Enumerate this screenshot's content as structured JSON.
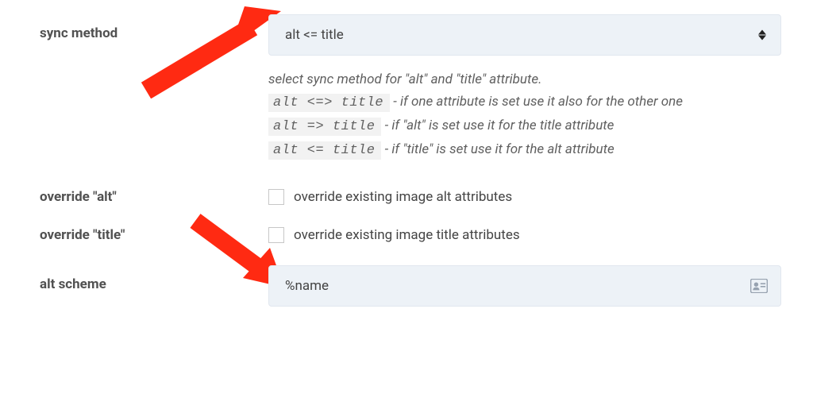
{
  "sync_method": {
    "label": "sync method",
    "selected": "alt <= title",
    "help_intro": "select sync method for \"alt\" and \"title\" attribute.",
    "opt1_code": "alt <=> title",
    "opt1_desc": " - if one attribute is set use it also for the other one",
    "opt2_code": "alt => title",
    "opt2_desc": " - if \"alt\" is set use it for the title attribute",
    "opt3_code": "alt <= title",
    "opt3_desc": " - if \"title\" is set use it for the alt attribute"
  },
  "override_alt": {
    "label": "override \"alt\"",
    "checkbox_label": "override existing image alt attributes"
  },
  "override_title": {
    "label": "override \"title\"",
    "checkbox_label": "override existing image title attributes"
  },
  "alt_scheme": {
    "label": "alt scheme",
    "value": "%name"
  }
}
